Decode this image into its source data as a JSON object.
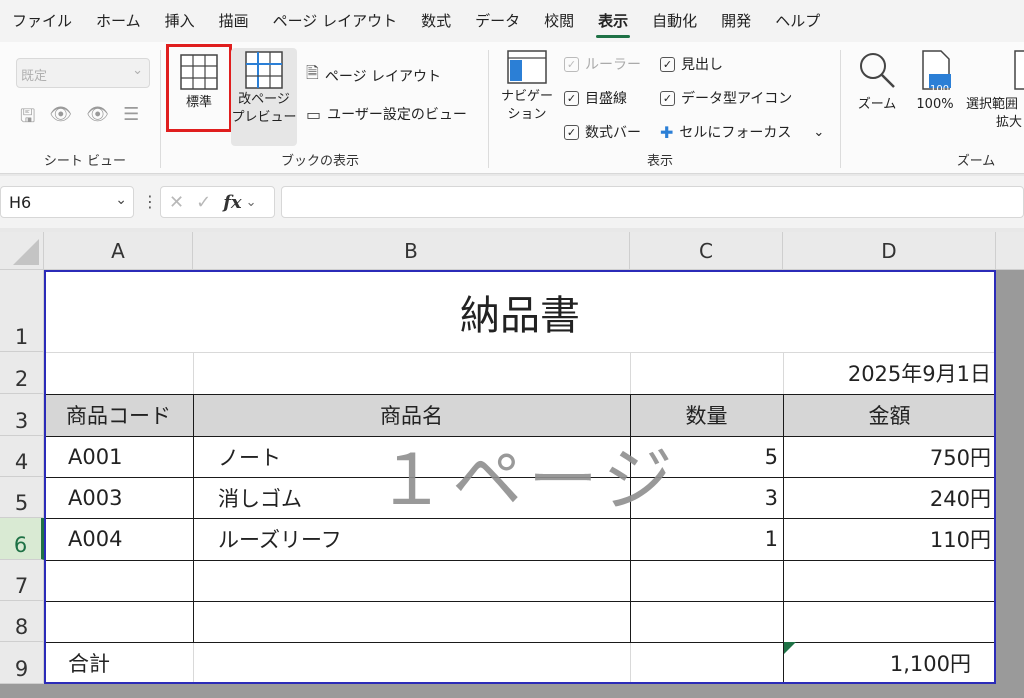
{
  "menu": {
    "tabs": [
      "ファイル",
      "ホーム",
      "挿入",
      "描画",
      "ページ レイアウト",
      "数式",
      "データ",
      "校閲",
      "表示",
      "自動化",
      "開発",
      "ヘルプ"
    ],
    "active_tab": "表示"
  },
  "ribbon": {
    "sheet_view": {
      "select_value": "既定",
      "group_label": "シート ビュー"
    },
    "book_view": {
      "normal_label": "標準",
      "page_break_line1": "改ページ",
      "page_break_line2": "プレビュー",
      "page_layout_label": "ページ レイアウト",
      "custom_view_label": "ユーザー設定のビュー",
      "group_label": "ブックの表示"
    },
    "show": {
      "navigation_line1": "ナビゲー",
      "navigation_line2": "ション",
      "ruler_label": "ルーラー",
      "gridlines_label": "目盛線",
      "formula_bar_label": "数式バー",
      "headings_label": "見出し",
      "data_type_icons_label": "データ型アイコン",
      "focus_cell_label": "セルにフォーカス",
      "group_label": "表示"
    },
    "zoom": {
      "zoom_label": "ズーム",
      "hundred_label": "100%",
      "hundred_icon_text": "100",
      "zoom_selection_line1": "選択範囲",
      "zoom_selection_line2": "拡大",
      "group_label": "ズーム"
    }
  },
  "formula_bar": {
    "name_box": "H6",
    "fx_label": "fx",
    "formula": ""
  },
  "columns": [
    "A",
    "B",
    "C",
    "D"
  ],
  "rows": [
    "1",
    "2",
    "3",
    "4",
    "5",
    "6",
    "7",
    "8",
    "9"
  ],
  "selected_row": "6",
  "sheet": {
    "title": "納品書",
    "date": "2025年9月1日",
    "headers": {
      "code": "商品コード",
      "name": "商品名",
      "qty": "数量",
      "amount": "金額"
    },
    "items": [
      {
        "code": "A001",
        "name": "ノート",
        "qty": "5",
        "amount": "750円"
      },
      {
        "code": "A003",
        "name": "消しゴム",
        "qty": "3",
        "amount": "240円"
      },
      {
        "code": "A004",
        "name": "ルーズリーフ",
        "qty": "1",
        "amount": "110円"
      }
    ],
    "total_label": "合計",
    "total_value": "1,100円",
    "watermark": "１ページ"
  }
}
